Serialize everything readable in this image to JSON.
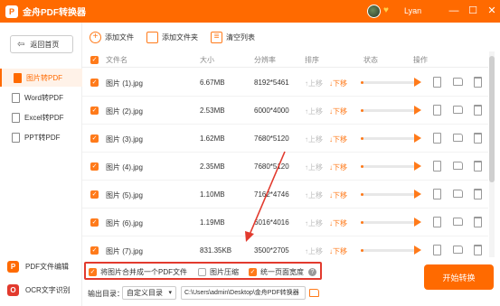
{
  "app": {
    "title": "金舟PDF转换器",
    "logo_char": "P",
    "username": "Lyan",
    "window_controls": [
      "—",
      "☐",
      "✕"
    ]
  },
  "sidebar": {
    "home_label": "返回首页",
    "items": [
      {
        "label": "图片转PDF",
        "active": true
      },
      {
        "label": "Word转PDF",
        "active": false
      },
      {
        "label": "Excel转PDF",
        "active": false
      },
      {
        "label": "PPT转PDF",
        "active": false
      }
    ],
    "bottom": [
      {
        "label": "PDF文件编辑",
        "icon": "P",
        "color": "#ff6a00"
      },
      {
        "label": "OCR文字识别",
        "icon": "O",
        "color": "#e23a2e"
      }
    ]
  },
  "toolbar": {
    "add_file": "添加文件",
    "add_folder": "添加文件夹",
    "clear_list": "清空列表"
  },
  "table": {
    "headers": {
      "name": "文件名",
      "size": "大小",
      "resolution": "分辨率",
      "sort": "排序",
      "status": "状态",
      "action": "操作"
    },
    "up_label": "上移",
    "down_label": "下移",
    "rows": [
      {
        "name": "图片 (1).jpg",
        "size": "6.67MB",
        "res": "8192*5461",
        "progress": 0.05
      },
      {
        "name": "图片 (2).jpg",
        "size": "2.53MB",
        "res": "6000*4000",
        "progress": 0.05
      },
      {
        "name": "图片 (3).jpg",
        "size": "1.62MB",
        "res": "7680*5120",
        "progress": 0.05
      },
      {
        "name": "图片 (4).jpg",
        "size": "2.35MB",
        "res": "7680*5120",
        "progress": 0.05
      },
      {
        "name": "图片 (5).jpg",
        "size": "1.10MB",
        "res": "7162*4746",
        "progress": 0.05
      },
      {
        "name": "图片 (6).jpg",
        "size": "1.19MB",
        "res": "6016*4016",
        "progress": 0.05
      },
      {
        "name": "图片 (7).jpg",
        "size": "831.35KB",
        "res": "3500*2705",
        "progress": 0.05
      }
    ]
  },
  "options": {
    "merge": {
      "label": "将图片合并成一个PDF文件",
      "checked": true
    },
    "compress": {
      "label": "图片压缩",
      "checked": false
    },
    "uniform_width": {
      "label": "统一页面宽度",
      "checked": true
    }
  },
  "output": {
    "label": "输出目录：",
    "mode": "自定义目录",
    "path": "C:\\Users\\admin\\Desktop\\金舟PDF转换器"
  },
  "start_button": "开始转换",
  "colors": {
    "brand": "#ff6a00",
    "highlight": "#e23a2e"
  }
}
